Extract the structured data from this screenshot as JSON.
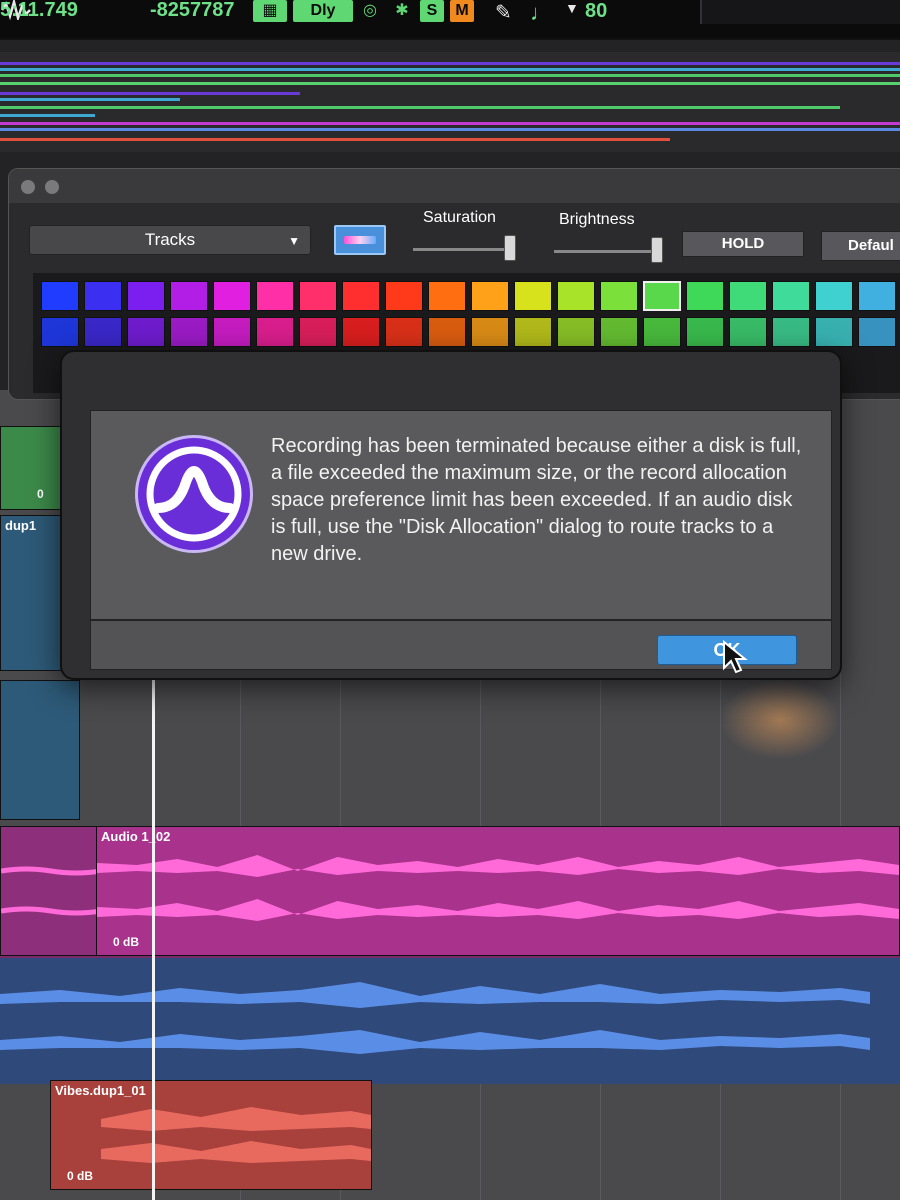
{
  "transport": {
    "counter": "5:11.749",
    "samples": "-8257787",
    "delay_label": "Dly",
    "solo_label": "S",
    "mute_label": "M",
    "tempo": "80"
  },
  "palette": {
    "target_select": "Tracks",
    "saturation_label": "Saturation",
    "brightness_label": "Brightness",
    "saturation_level": 0.95,
    "brightness_level": 0.95,
    "hold_label": "HOLD",
    "default_label": "Defaul",
    "swatch_rows": [
      [
        "#1f3cff",
        "#3b2ff2",
        "#7a1ff0",
        "#b21ee6",
        "#e11fe0",
        "#ff2fa8",
        "#ff2f6c",
        "#ff2f2f",
        "#ff3a1a",
        "#ff6f12",
        "#ffa21a",
        "#d8e21c",
        "#a8e32a",
        "#7be03a",
        "#58d84a",
        "#3fd95a",
        "#3fdb78",
        "#3fdb9a",
        "#3fd0d0",
        "#3fb0e0"
      ],
      [
        "#1e36d8",
        "#3a27c8",
        "#6e1ccc",
        "#9a1bc4",
        "#c41cbf",
        "#d81e8c",
        "#d81e5a",
        "#d81e1e",
        "#d83018",
        "#d85c10",
        "#d88a16",
        "#b0b81a",
        "#86bc26",
        "#63ba30",
        "#48b83c",
        "#38b84c",
        "#38ba66",
        "#38ba84",
        "#38b0b0",
        "#3892c0"
      ]
    ]
  },
  "dialog": {
    "message": "Recording has been terminated because either a disk is full, a file exceeded the maximum size, or the record allocation space preference limit has been exceeded. If an audio disk is full, use the \"Disk Allocation\" dialog to route tracks to a new drive.",
    "ok_label": "OK"
  },
  "edit": {
    "clip_top_gain": "0",
    "track_name_dup1": "dup1",
    "audio_clip_name": "Audio 1_02",
    "audio_clip_gain": "0 dB",
    "vibes_clip_name": "Vibes.dup1_01",
    "vibes_clip_gain": "0 dB"
  },
  "colors": {
    "transport_green": "#6fe08a",
    "mute_orange": "#f08a1e",
    "ok_blue": "#3f95de",
    "icon_purple": "#6a2ed8",
    "clip_magenta": "#a8328c",
    "clip_blue": "#2f4a7a",
    "clip_red": "#a8403c"
  }
}
